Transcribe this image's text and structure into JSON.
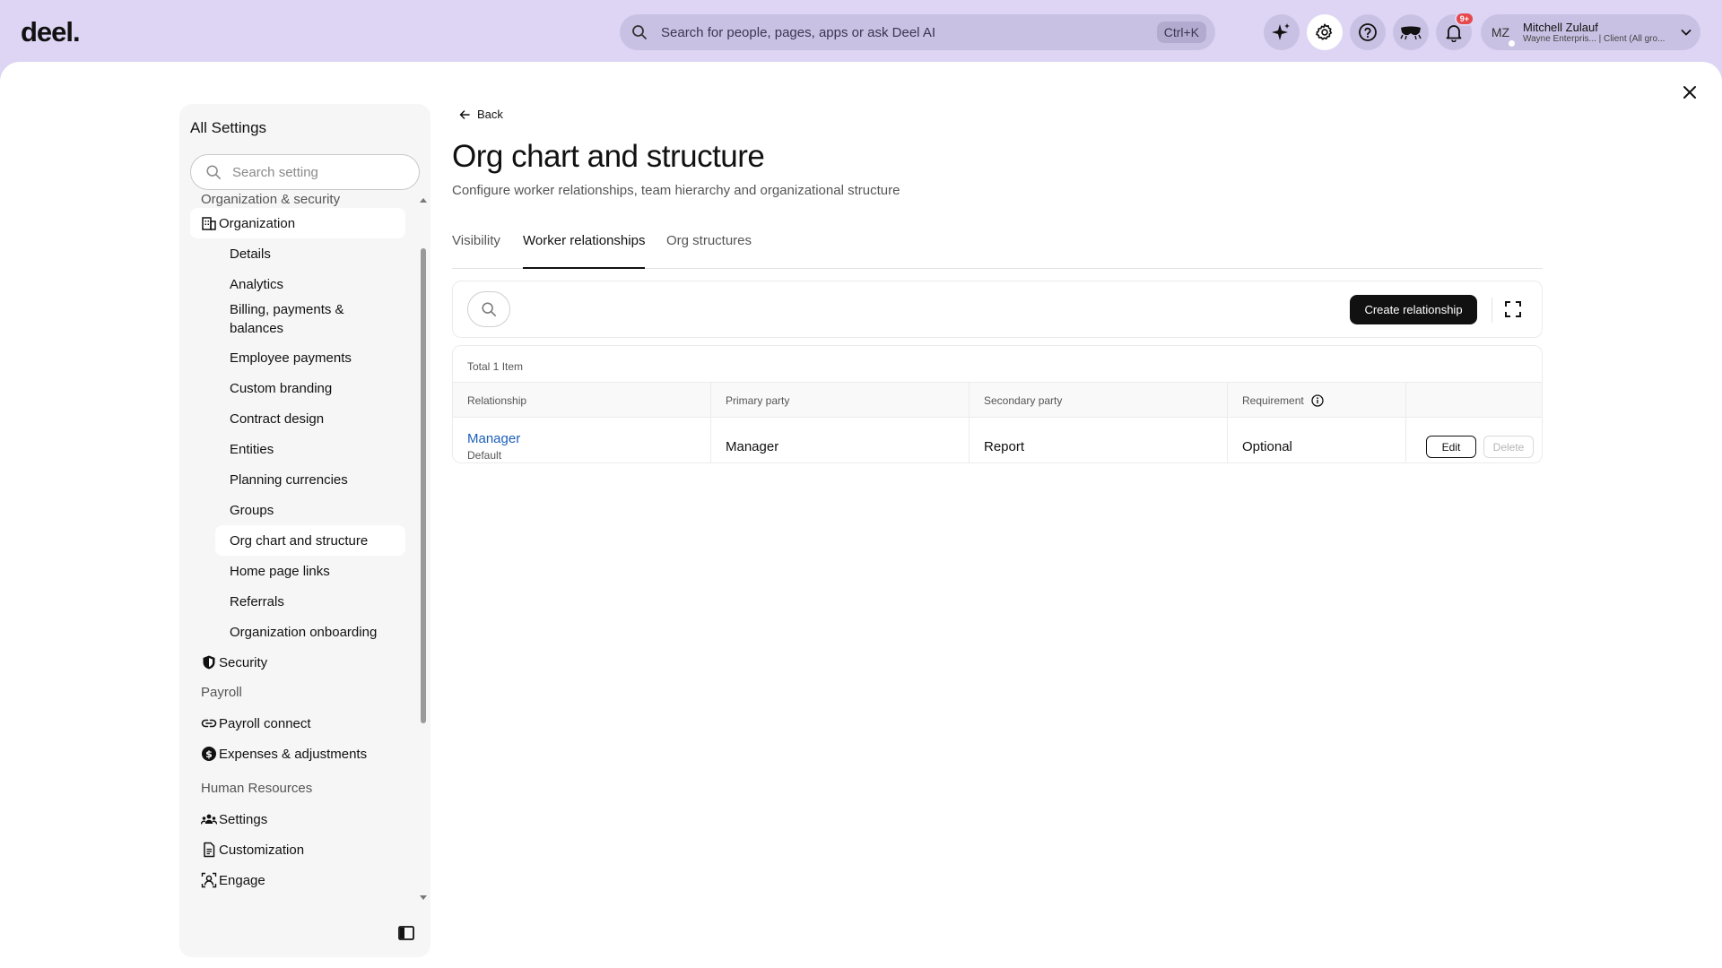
{
  "app": {
    "logo": "deel."
  },
  "topbar": {
    "search_placeholder": "Search for people, pages, apps or ask Deel AI",
    "shortcut": "Ctrl+K",
    "notification_badge": "9+",
    "user": {
      "initials": "MZ",
      "name": "Mitchell Zulauf",
      "subtitle": "Wayne Enterpris... | Client (All gro..."
    }
  },
  "sidebar": {
    "title": "All Settings",
    "search_placeholder": "Search setting",
    "sections": {
      "org_security": "Organization & security",
      "payroll": "Payroll",
      "hr": "Human Resources"
    },
    "organization": "Organization",
    "org_items": [
      "Details",
      "Analytics",
      "Billing, payments & balances",
      "Employee payments",
      "Custom branding",
      "Contract design",
      "Entities",
      "Planning currencies",
      "Groups",
      "Org chart and structure",
      "Home page links",
      "Referrals",
      "Organization onboarding"
    ],
    "security": "Security",
    "payroll_items": [
      "Payroll connect",
      "Expenses & adjustments"
    ],
    "hr_items": [
      "Settings",
      "Customization",
      "Engage"
    ]
  },
  "page": {
    "back": "Back",
    "title": "Org chart and structure",
    "description": "Configure worker relationships, team hierarchy and organizational structure",
    "tabs": [
      "Visibility",
      "Worker relationships",
      "Org structures"
    ],
    "active_tab": "Worker relationships"
  },
  "toolbar": {
    "create_button": "Create relationship"
  },
  "table": {
    "total": "Total 1 Item",
    "columns": [
      "Relationship",
      "Primary party",
      "Secondary party",
      "Requirement"
    ],
    "rows": [
      {
        "relationship": "Manager",
        "relationship_sub": "Default",
        "primary": "Manager",
        "secondary": "Report",
        "requirement": "Optional",
        "edit": "Edit",
        "delete": "Delete"
      }
    ]
  }
}
